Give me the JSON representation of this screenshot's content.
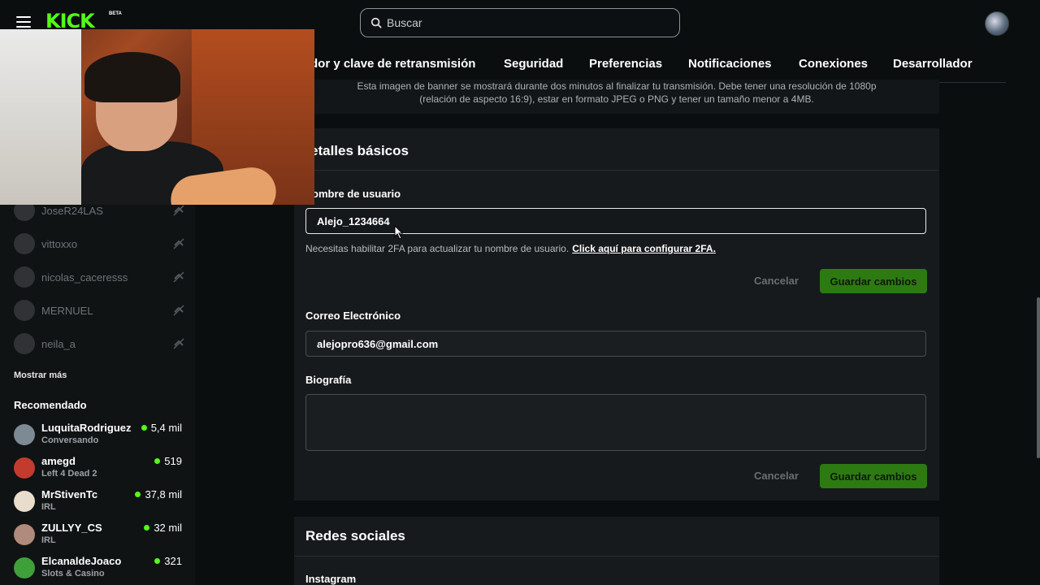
{
  "header": {
    "logo": "KICK",
    "beta": "BETA",
    "search_placeholder": "Buscar"
  },
  "tabs": [
    "dor y clave de retransmisión",
    "Seguridad",
    "Preferencias",
    "Notificaciones",
    "Conexiones",
    "Desarrollador"
  ],
  "banner_note": {
    "line1": "Esta imagen de banner se mostrará durante dos minutos al finalizar tu transmisión. Debe tener una resolución de 1080p",
    "line2": "(relación de aspecto 16:9), estar en formato JPEG o PNG y tener un tamaño menor a 4MB."
  },
  "basic": {
    "title": "etalles básicos",
    "username_label": "ombre de usuario",
    "username_value": "Alejo_1234664",
    "hint": "Necesitas habilitar 2FA para actualizar tu nombre de usuario.",
    "hint_link": "Click aquí para configurar 2FA.",
    "cancel": "Cancelar",
    "save": "Guardar cambios",
    "email_label": "Correo Electrónico",
    "email_value": "alejopro636@gmail.com",
    "bio_label": "Biografía",
    "bio_value": ""
  },
  "social": {
    "title": "Redes sociales",
    "instagram_label": "Instagram"
  },
  "sidebar": {
    "following": [
      {
        "name": "JoseR24LAS"
      },
      {
        "name": "vittoxxo"
      },
      {
        "name": "nicolas_caceresss"
      },
      {
        "name": "MERNUEL"
      },
      {
        "name": "neila_a"
      }
    ],
    "show_more": "Mostrar más",
    "recommended_title": "Recomendado",
    "recommended": [
      {
        "name": "LuquitaRodriguez",
        "category": "Conversando",
        "viewers": "5,4 mil",
        "color": "#7d8a94"
      },
      {
        "name": "amegd",
        "category": "Left 4 Dead 2",
        "viewers": "519",
        "color": "#c23b2e"
      },
      {
        "name": "MrStivenTc",
        "category": "IRL",
        "viewers": "37,8 mil",
        "color": "#e8dccc"
      },
      {
        "name": "ZULLYY_CS",
        "category": "IRL",
        "viewers": "32 mil",
        "color": "#b08a7a"
      },
      {
        "name": "ElcanaldeJoaco",
        "category": "Slots & Casino",
        "viewers": "321",
        "color": "#3fa03a"
      }
    ]
  },
  "colors": {
    "brand": "#53fc18",
    "save_button": "#2d7a12",
    "background": "#0b0e0f"
  }
}
